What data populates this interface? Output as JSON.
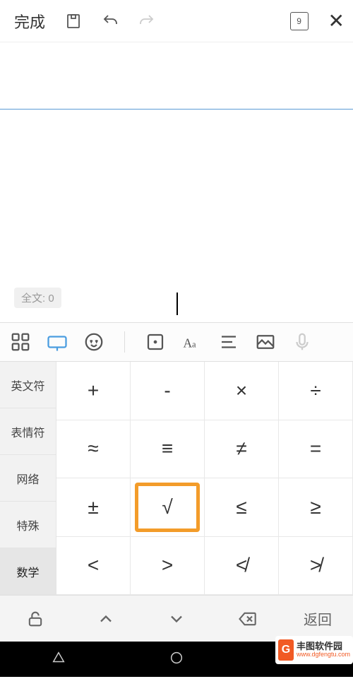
{
  "top": {
    "done": "完成",
    "page_count": "9"
  },
  "doc": {
    "word_count": "全文: 0"
  },
  "categories": [
    "英文符",
    "表情符",
    "网络",
    "特殊",
    "数学"
  ],
  "active_category_index": 4,
  "symbols": [
    [
      "+",
      "-",
      "×",
      "÷"
    ],
    [
      "≈",
      "≡",
      "≠",
      "="
    ],
    [
      "±",
      "√",
      "≤",
      "≥"
    ],
    [
      "<",
      ">",
      "≮",
      "≯"
    ]
  ],
  "highlight": {
    "row": 2,
    "col": 1
  },
  "bottom": {
    "back": "返回"
  },
  "watermark": {
    "logo": "G",
    "name": "丰图软件园",
    "url": "www.dgfengtu.com"
  }
}
